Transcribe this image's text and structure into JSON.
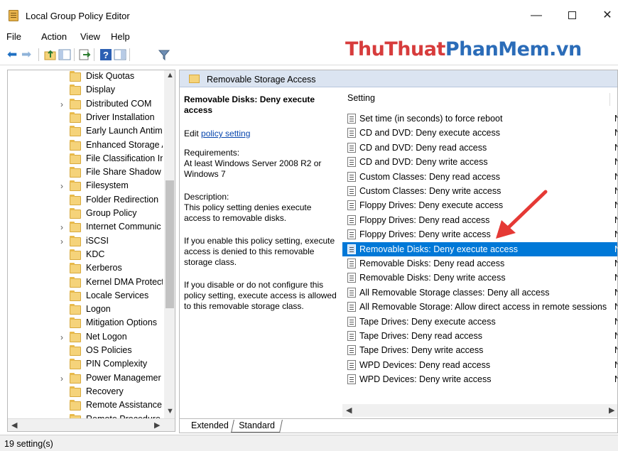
{
  "window": {
    "title": "Local Group Policy Editor",
    "minimize": "—",
    "close": "✕"
  },
  "menu": [
    "File",
    "Action",
    "View",
    "Help"
  ],
  "watermark": {
    "part1": "ThuThuat",
    "part2": "PhanMem",
    "part3": ".vn"
  },
  "tree": {
    "items": [
      {
        "label": "Disk Quotas",
        "expandable": false
      },
      {
        "label": "Display",
        "expandable": false
      },
      {
        "label": "Distributed COM",
        "expandable": true
      },
      {
        "label": "Driver Installation",
        "expandable": false
      },
      {
        "label": "Early Launch Antim",
        "expandable": false
      },
      {
        "label": "Enhanced Storage A",
        "expandable": false
      },
      {
        "label": "File Classification In",
        "expandable": false
      },
      {
        "label": "File Share Shadow C",
        "expandable": false
      },
      {
        "label": "Filesystem",
        "expandable": true
      },
      {
        "label": "Folder Redirection",
        "expandable": false
      },
      {
        "label": "Group Policy",
        "expandable": false
      },
      {
        "label": "Internet Communic",
        "expandable": true
      },
      {
        "label": "iSCSI",
        "expandable": true
      },
      {
        "label": "KDC",
        "expandable": false
      },
      {
        "label": "Kerberos",
        "expandable": false
      },
      {
        "label": "Kernel DMA Protect",
        "expandable": false
      },
      {
        "label": "Locale Services",
        "expandable": false
      },
      {
        "label": "Logon",
        "expandable": false
      },
      {
        "label": "Mitigation Options",
        "expandable": false
      },
      {
        "label": "Net Logon",
        "expandable": true
      },
      {
        "label": "OS Policies",
        "expandable": false
      },
      {
        "label": "PIN Complexity",
        "expandable": false
      },
      {
        "label": "Power Managemer",
        "expandable": true
      },
      {
        "label": "Recovery",
        "expandable": false
      },
      {
        "label": "Remote Assistance",
        "expandable": false
      },
      {
        "label": "Remote Procedure",
        "expandable": false
      }
    ]
  },
  "path_header": "Removable Storage Access",
  "description": {
    "title": "Removable Disks: Deny execute access",
    "edit_prefix": "Edit",
    "edit_link": "policy setting",
    "requirements_label": "Requirements:",
    "requirements": "At least Windows Server 2008 R2 or Windows 7",
    "description_label": "Description:",
    "description": "This policy setting denies execute access to removable disks.",
    "enabled": "If you enable this policy setting, execute access is denied to this removable storage class.",
    "disabled": "If you disable or do not configure this policy setting, execute access is allowed to this removable storage class."
  },
  "list": {
    "header": "Setting",
    "selected_index": 9,
    "items": [
      "Set time (in seconds) to force reboot",
      "CD and DVD: Deny execute access",
      "CD and DVD: Deny read access",
      "CD and DVD: Deny write access",
      "Custom Classes: Deny read access",
      "Custom Classes: Deny write access",
      "Floppy Drives: Deny execute access",
      "Floppy Drives: Deny read access",
      "Floppy Drives: Deny write access",
      "Removable Disks: Deny execute access",
      "Removable Disks: Deny read access",
      "Removable Disks: Deny write access",
      "All Removable Storage classes: Deny all access",
      "All Removable Storage: Allow direct access in remote sessions",
      "Tape Drives: Deny execute access",
      "Tape Drives: Deny read access",
      "Tape Drives: Deny write access",
      "WPD Devices: Deny read access",
      "WPD Devices: Deny write access"
    ],
    "truncated_state": "N"
  },
  "tabs": [
    "Extended",
    "Standard"
  ],
  "status": "19 setting(s)",
  "colors": {
    "selection": "#0078d7",
    "annotation_arrow": "#e53935",
    "header_bg": "#dbe4f1"
  }
}
